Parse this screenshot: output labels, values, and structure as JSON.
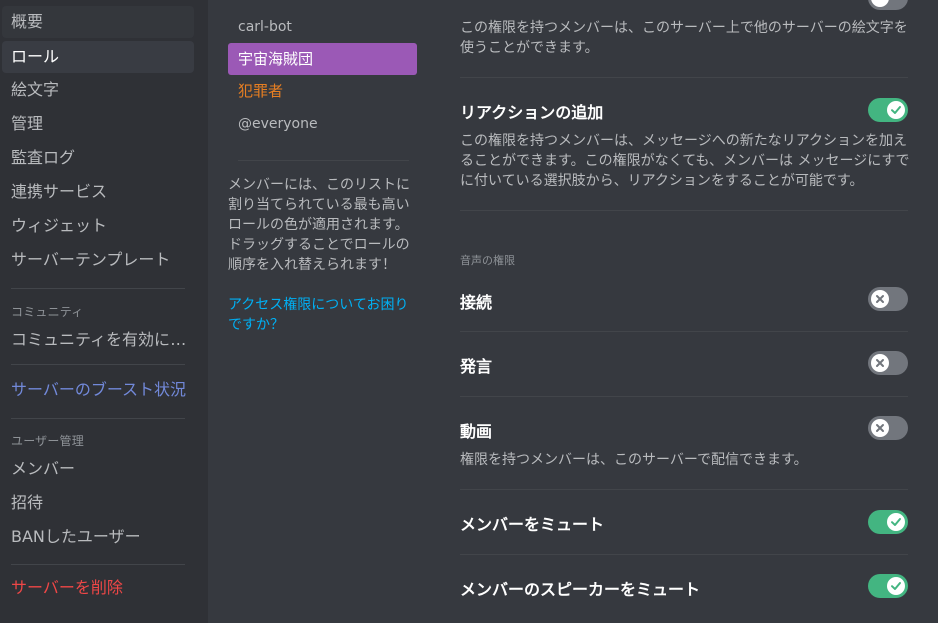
{
  "sidebar": {
    "items": [
      {
        "label": "概要"
      },
      {
        "label": "ロール"
      },
      {
        "label": "絵文字"
      },
      {
        "label": "管理"
      },
      {
        "label": "監査ログ"
      },
      {
        "label": "連携サービス"
      },
      {
        "label": "ウィジェット"
      },
      {
        "label": "サーバーテンプレート"
      }
    ],
    "community_header": "コミュニティ",
    "community_item": "コミュニティを有効にする",
    "boost_item": "サーバーのブースト状況",
    "user_mgmt_header": "ユーザー管理",
    "user_items": [
      {
        "label": "メンバー"
      },
      {
        "label": "招待"
      },
      {
        "label": "BANしたユーザー"
      }
    ],
    "delete_label": "サーバーを削除"
  },
  "roles": {
    "items": [
      {
        "label": "carl-bot"
      },
      {
        "label": "宇宙海賊団"
      },
      {
        "label": "犯罪者"
      },
      {
        "label": "@everyone"
      }
    ],
    "info": "メンバーには、このリストに割り当てられている最も高いロールの色が適用されます。ドラッグすることでロールの順序を入れ替えられます！",
    "help_link": "アクセス権限についてお困りですか？"
  },
  "permissions": {
    "external_emoji_desc": "この権限を持つメンバーは、このサーバー上で他のサーバーの絵文字を使うことができます。",
    "add_reactions": {
      "title": "リアクションの追加",
      "desc": "この権限を持つメンバーは、メッセージへの新たなリアクションを加えることができます。この権限がなくても、メンバーは メッセージにすでに付いている選択肢から、リアクションをすることが可能です。",
      "enabled": true
    },
    "voice_header": "音声の権限",
    "connect": {
      "title": "接続",
      "enabled": false
    },
    "speak": {
      "title": "発言",
      "enabled": false
    },
    "video": {
      "title": "動画",
      "desc": "権限を持つメンバーは、このサーバーで配信できます。",
      "enabled": false
    },
    "mute_members": {
      "title": "メンバーをミュート",
      "enabled": true
    },
    "deafen_members": {
      "title": "メンバーのスピーカーをミュート",
      "enabled": true
    }
  },
  "colors": {
    "sidebar_bg": "#2f3136",
    "content_bg": "#36393f",
    "role_selected": "#9b59b6",
    "role_criminal": "#e67e22",
    "toggle_on": "#43b581",
    "toggle_off": "#72767d",
    "link": "#00b0f4",
    "boost": "#7289da",
    "danger": "#f04747"
  }
}
